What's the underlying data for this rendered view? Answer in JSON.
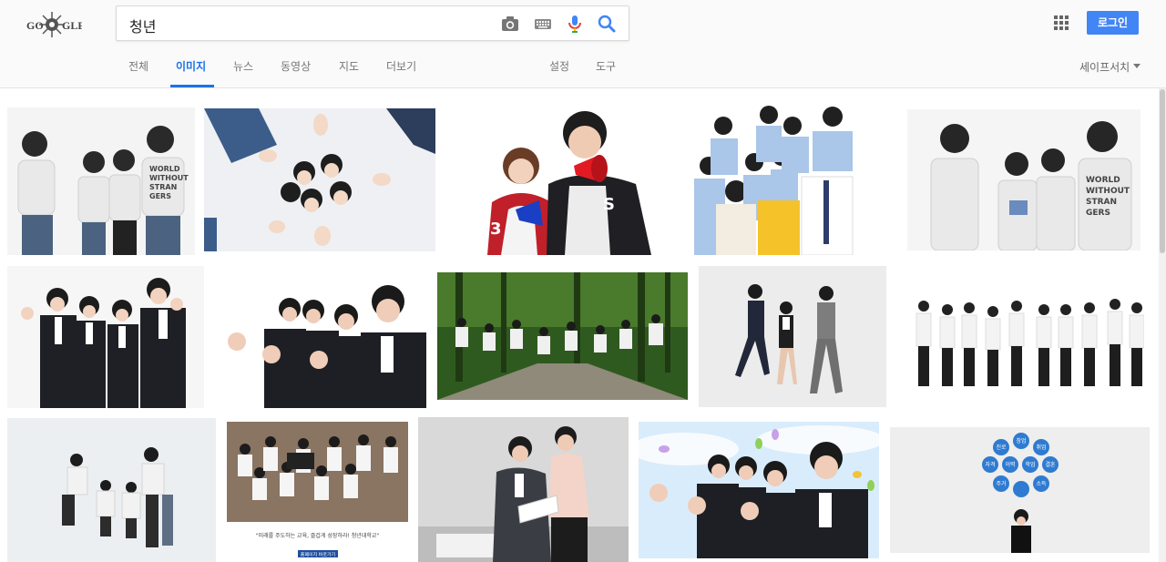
{
  "search": {
    "query": "청년"
  },
  "header": {
    "login_label": "로그인"
  },
  "tabs": [
    {
      "label": "전체"
    },
    {
      "label": "이미지"
    },
    {
      "label": "뉴스"
    },
    {
      "label": "동영상"
    },
    {
      "label": "지도"
    },
    {
      "label": "더보기"
    },
    {
      "label": "설정"
    },
    {
      "label": "도구"
    }
  ],
  "safe_search": {
    "label": "세이프서치"
  },
  "colors": {
    "accent": "#1a73e8",
    "login_bg": "#4285f4"
  },
  "icons": [
    "doodle-logo",
    "camera-icon",
    "keyboard-icon",
    "microphone-icon",
    "search-icon",
    "apps-grid-icon",
    "caret-down-icon"
  ],
  "thumbnails": {
    "t9": {
      "caption": "\"미래를 주도하는 교육, 즐겁게 성장하라! 청년대학교\"",
      "button": "홈페이지 바로가기"
    },
    "t13": {
      "bubbles": [
        "창업",
        "진로",
        "취업",
        "자격",
        "이력",
        "학업",
        "결혼",
        "주거",
        "소득"
      ]
    }
  }
}
